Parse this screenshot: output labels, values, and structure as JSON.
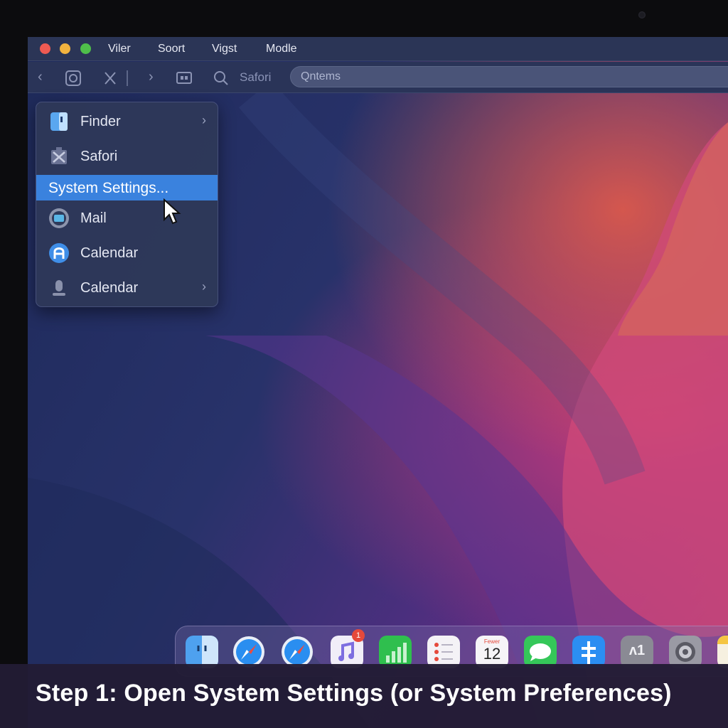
{
  "menubar": {
    "items": [
      "Viler",
      "Soort",
      "Vigst",
      "Modle"
    ]
  },
  "toolbar": {
    "label": "Safori",
    "search_value": "Qntems"
  },
  "dropdown": {
    "items": [
      {
        "label": "Finder",
        "icon": "finder-icon",
        "has_submenu": true
      },
      {
        "label": "Safori",
        "icon": "safari-icon",
        "has_submenu": false
      },
      {
        "label": "System Settings...",
        "icon": "",
        "has_submenu": false,
        "selected": true
      },
      {
        "label": "Mail",
        "icon": "mail-icon",
        "has_submenu": false
      },
      {
        "label": "Calendar",
        "icon": "calendar-icon",
        "has_submenu": false
      },
      {
        "label": "Calendar",
        "icon": "podcast-icon",
        "has_submenu": true
      }
    ]
  },
  "dock": {
    "music_badge": "1",
    "calendar_month": "Fewer",
    "calendar_day": "12",
    "app5_text": "ʌ1"
  },
  "caption": "Step 1: Open System Settings (or System Preferences)",
  "colors": {
    "highlight": "#3a82de",
    "menubar": "#2b3556",
    "caption_bg": "#221c34"
  }
}
